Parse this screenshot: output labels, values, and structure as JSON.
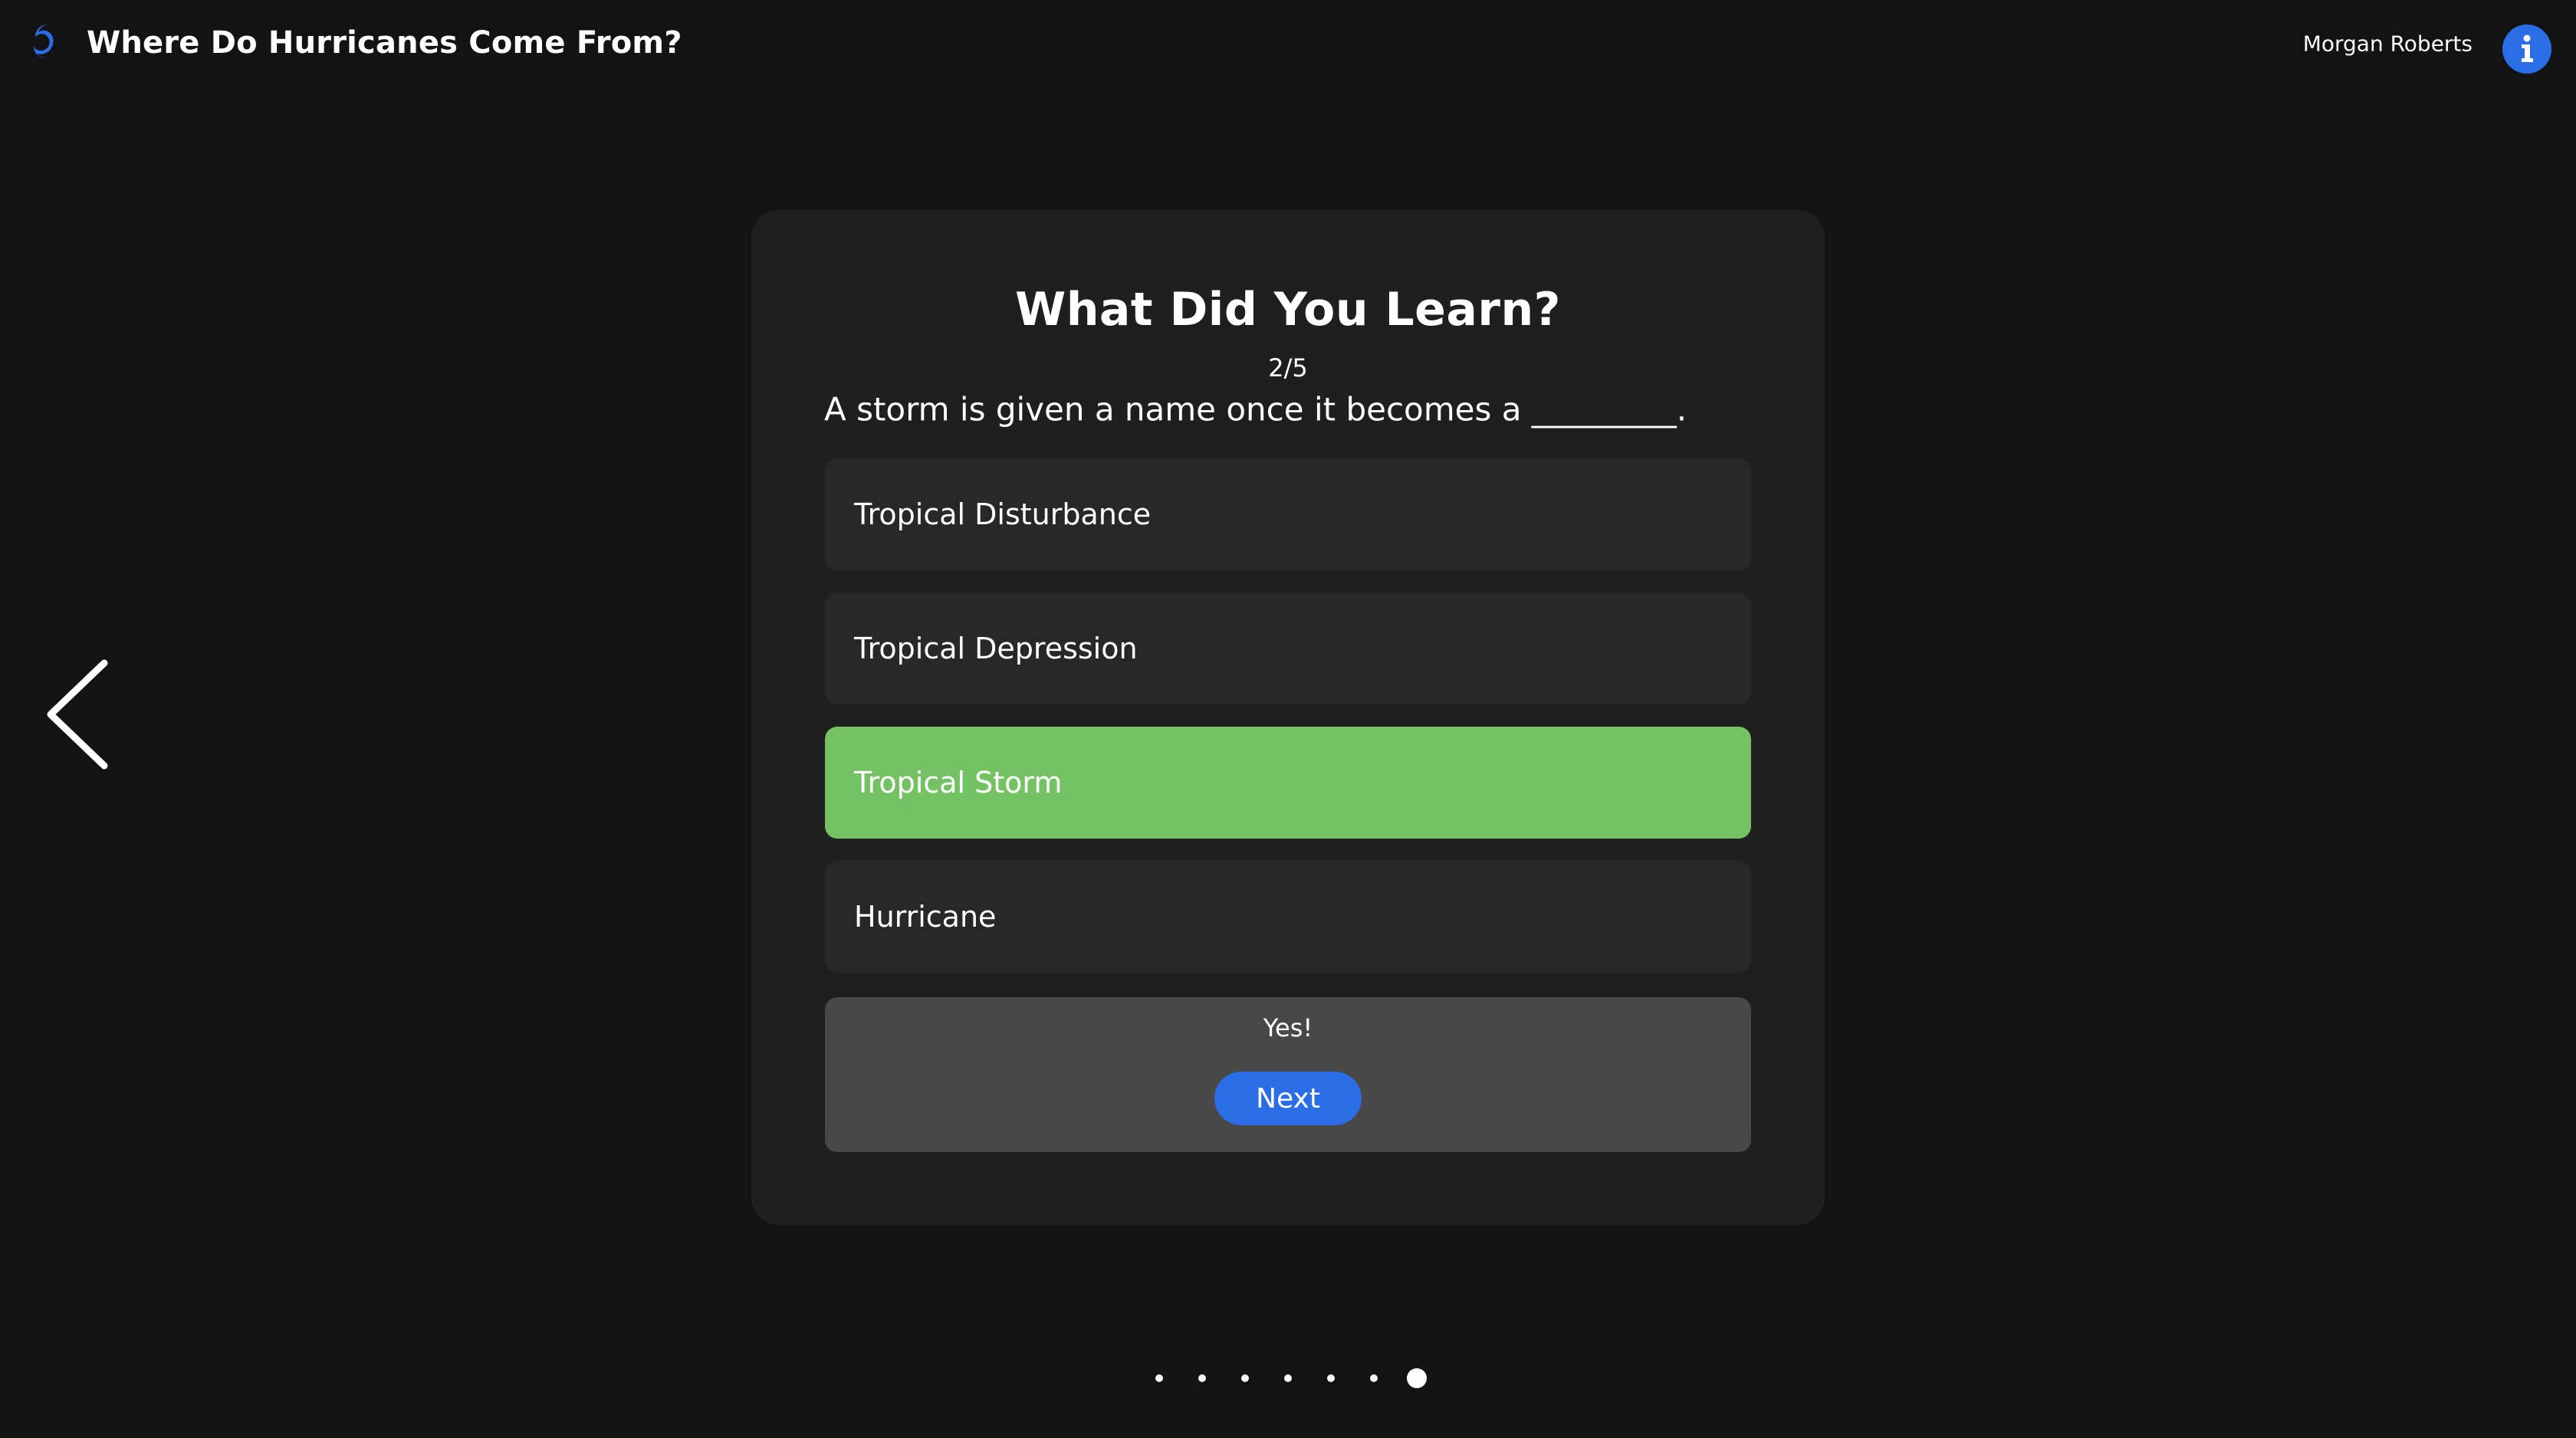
{
  "header": {
    "logo_icon": "hurricane-icon",
    "title": "Where Do Hurricanes Come From?",
    "user_name": "Morgan Roberts",
    "info_icon": "info-icon"
  },
  "navigation": {
    "prev_icon": "chevron-left-icon"
  },
  "quiz": {
    "title": "What Did You Learn?",
    "progress": "2/5",
    "question": "A storm is given a name once it becomes a _________.",
    "options": [
      {
        "label": "Tropical Disturbance",
        "selected": false
      },
      {
        "label": "Tropical Depression",
        "selected": false
      },
      {
        "label": "Tropical Storm",
        "selected": true
      },
      {
        "label": "Hurricane",
        "selected": false
      }
    ],
    "feedback": "Yes!",
    "next_label": "Next"
  },
  "pagination": {
    "total": 7,
    "active_index": 6
  },
  "colors": {
    "background": "#131313",
    "card": "#1f1f1f",
    "option": "#282828",
    "correct": "#75c265",
    "feedback_panel": "#484848",
    "accent": "#2b6de6"
  }
}
